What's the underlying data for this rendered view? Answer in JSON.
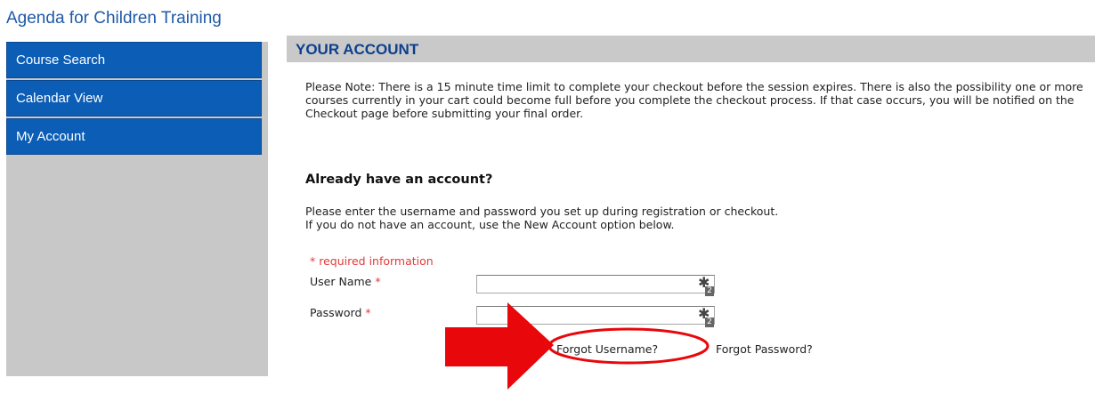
{
  "site": {
    "title": "Agenda for Children Training"
  },
  "sidebar": {
    "items": [
      {
        "label": "Course Search"
      },
      {
        "label": "Calendar View"
      },
      {
        "label": "My Account"
      }
    ]
  },
  "main": {
    "header": "YOUR ACCOUNT",
    "note": "Please Note: There is a 15 minute time limit to complete your checkout before the session expires. There is also the possibility one or more courses currently in your cart could become full before you complete the checkout process. If that case occurs, you will be notified on the Checkout page before submitting your final order.",
    "login": {
      "heading": "Already have an account?",
      "instruction_line1": "Please enter the username and password you set up during registration or checkout.",
      "instruction_line2": "If you do not have an account, use the New Account option below.",
      "required_note": "* required information",
      "username_label": "User Name",
      "password_label": "Password",
      "required_marker": "*",
      "forgot_username": "Forgot Username?",
      "forgot_password": "Forgot Password?",
      "password_manager_badge": "2"
    }
  },
  "colors": {
    "nav_bg": "#0b5db5",
    "sidebar_bg": "#c8c8c8",
    "header_bg": "#c9c9c9",
    "header_text": "#0c3f8e",
    "required": "#e03a3a",
    "annotation": "#e8070a"
  },
  "icons": {
    "field_icon": "password-manager-icon",
    "annotation_arrow": "red-arrow-icon",
    "annotation_circle": "red-circle-highlight"
  }
}
